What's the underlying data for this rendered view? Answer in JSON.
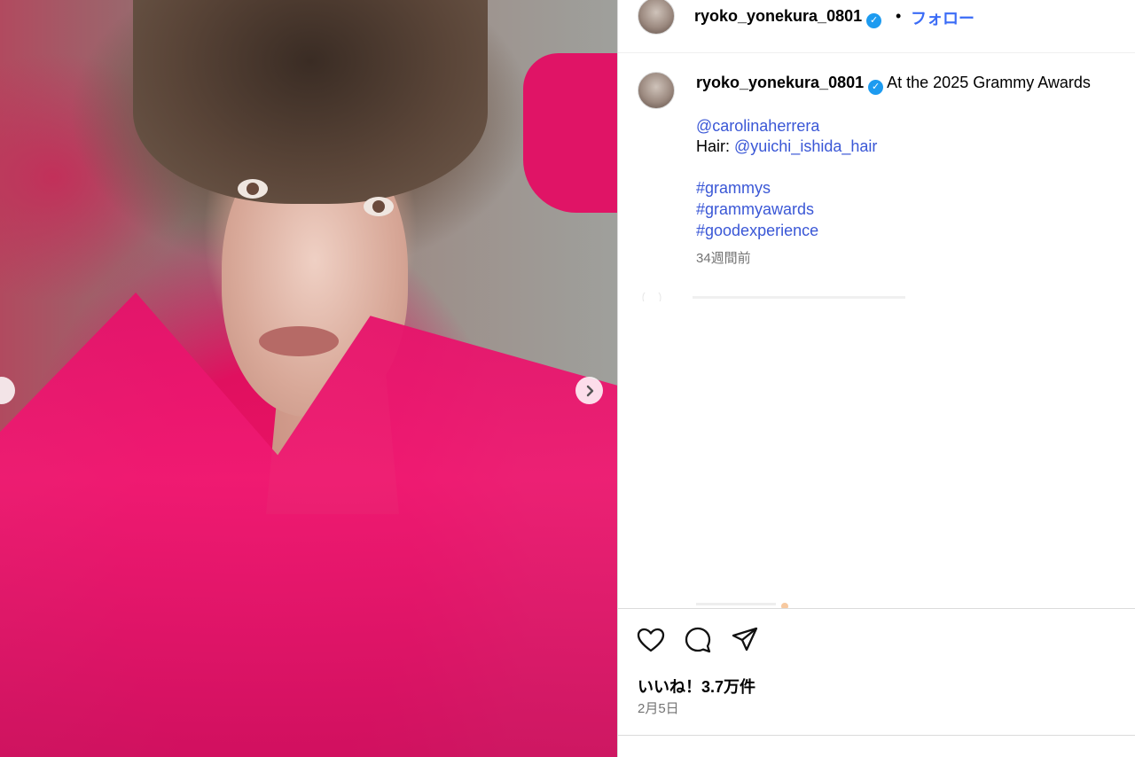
{
  "post": {
    "image_alt": "",
    "nav_next_icon": "chevron-right-icon"
  },
  "header": {
    "username": "ryoko_yonekura_0801",
    "verified_icon": "verified-badge-icon",
    "separator": "•",
    "follow_label": "フォロー"
  },
  "caption": {
    "username": "ryoko_yonekura_0801",
    "text": "At the 2025 Grammy Awards",
    "mention_1": "@carolinaherrera",
    "hair_label": "Hair: ",
    "mention_2": "@yuichi_ishida_hair",
    "hashtags": [
      "#grammys",
      "#grammyawards",
      "#goodexperience"
    ],
    "time_ago": "34週間前"
  },
  "actions": {
    "like_icon": "heart-icon",
    "comment_icon": "comment-icon",
    "share_icon": "send-icon",
    "likes_text": "いいね！3.7万件",
    "date": "2月5日"
  },
  "colors": {
    "link": "#3a57d6",
    "follow": "#3b6cf6",
    "verified": "#1d9bf0",
    "muted": "#737373"
  }
}
